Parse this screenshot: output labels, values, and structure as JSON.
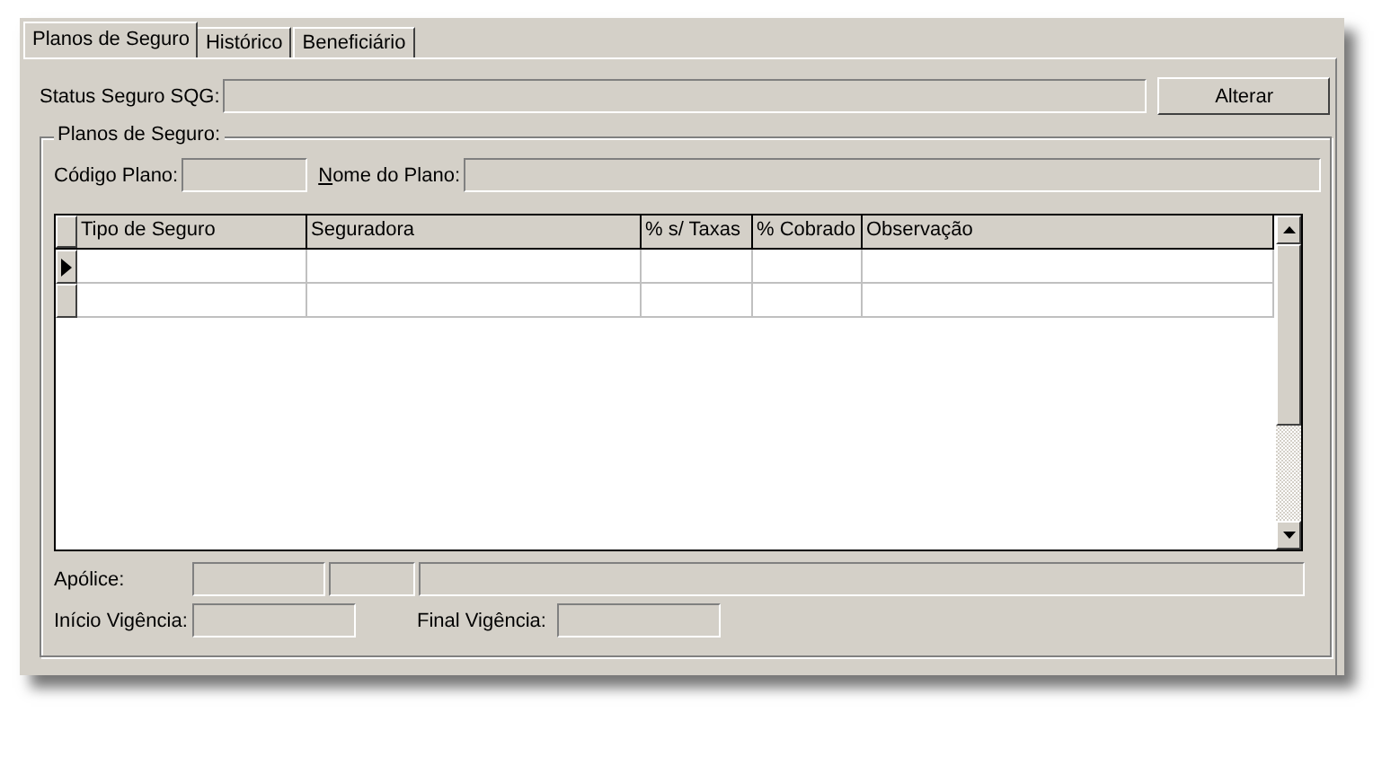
{
  "tabs": [
    {
      "label": "Planos de Seguro",
      "selected": true
    },
    {
      "label": "Histórico",
      "selected": false
    },
    {
      "label": "Beneficiário",
      "selected": false
    }
  ],
  "status": {
    "label": "Status Seguro SQG:"
  },
  "alter_button": "Alterar",
  "group": {
    "title": "Planos de Seguro:",
    "code": {
      "label": "Código Plano:"
    },
    "plan_name": {
      "label": "Nome do Plano:",
      "mnemonic": true
    },
    "table": {
      "columns": [
        "Tipo de Seguro",
        "Seguradora",
        "% s/ Taxas",
        "% Cobrado",
        "Observação"
      ],
      "rows": [
        {
          "current": true
        },
        {
          "current": false
        }
      ]
    },
    "policy": {
      "label": "Apólice:"
    },
    "start": {
      "label": "Início Vigência:"
    },
    "end": {
      "label": "Final Vigência:"
    }
  }
}
